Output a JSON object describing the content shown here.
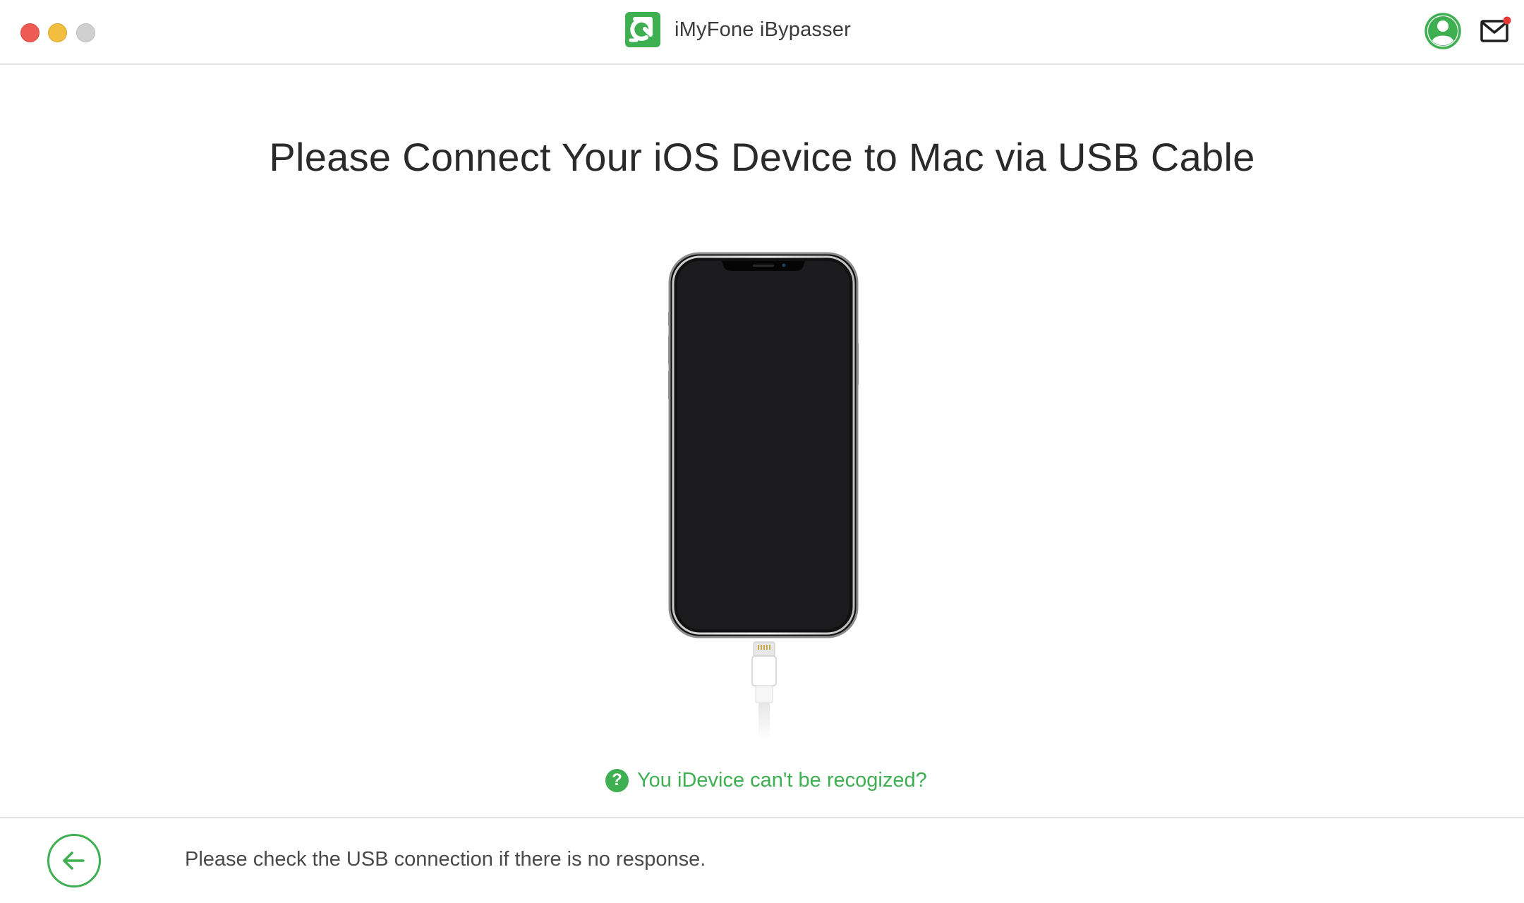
{
  "window": {
    "title": "iMyFone iBypasser",
    "brand_color": "#3eb052",
    "traffic_lights": {
      "close_color": "#ee5b54",
      "minimize_color": "#f3be3f",
      "zoom_color": "#d0d0d0"
    }
  },
  "header": {
    "account_icon": "user-circle-icon",
    "mail_icon": "mail-icon",
    "mail_has_notification": true,
    "notification_color": "#e53935"
  },
  "main": {
    "heading": "Please Connect Your iOS Device to Mac via USB Cable",
    "illustration": "iphone-with-lightning-cable",
    "help_icon": "question-circle-icon",
    "help_icon_glyph": "?",
    "help_link": "You iDevice can't be recogized?"
  },
  "footer": {
    "back_icon": "arrow-left-icon",
    "message": "Please check the USB connection if there is no response."
  }
}
